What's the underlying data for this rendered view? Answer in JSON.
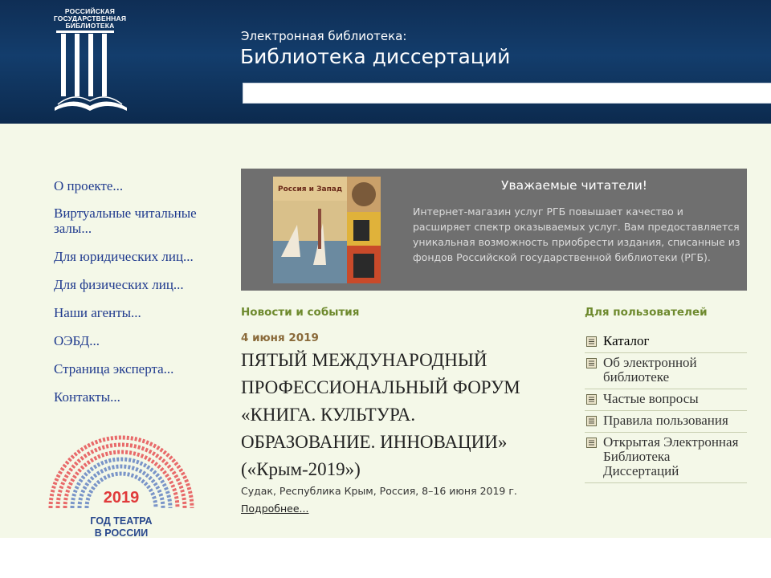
{
  "header": {
    "logo_lines": [
      "РОССИЙСКАЯ",
      "ГОСУДАРСТВЕННАЯ",
      "БИБЛИОТЕКА"
    ],
    "subtitle": "Электронная библиотека:",
    "title": "Библиотека диссертаций",
    "search_value": ""
  },
  "nav": {
    "items": [
      "О проекте...",
      "Виртуальные читальные залы...",
      "Для юридических лиц...",
      "Для физических лиц...",
      "Наши агенты...",
      "ОЭБД...",
      "Страница эксперта...",
      "Контакты..."
    ]
  },
  "theatre_logo": {
    "year": "2019",
    "caption_lines": [
      "ГОД ТЕАТРА",
      "В РОССИИ"
    ]
  },
  "banner": {
    "image_label": "Россия и Запад",
    "title": "Уважаемые читатели!",
    "text": "Интернет-магазин услуг РГБ повышает качество и расширяет спектр оказываемых услуг. Вам предоставляется уникальная возможность приобрести издания, списанные из фондов Российской государственной библиотеки (РГБ)."
  },
  "news": {
    "heading": "Новости и события",
    "date": "4 июня 2019",
    "title_lines": [
      "ПЯТЫЙ МЕЖДУНАРОДНЫЙ",
      "ПРОФЕССИОНАЛЬНЫЙ ФОРУМ",
      "«КНИГА. КУЛЬТУРА.",
      "ОБРАЗОВАНИЕ. ИННОВАЦИИ»",
      "(«Крым-2019»)"
    ],
    "place": "Судак, Республика Крым, Россия, 8–16 июня 2019 г.",
    "more": "Подробнее..."
  },
  "users": {
    "heading": "Для пользователей",
    "items": [
      "Каталог",
      "Об электронной библиотеке",
      "Частые вопросы",
      "Правила пользования",
      "Открытая Электронная Библиотека Диссертаций"
    ]
  },
  "colors": {
    "header_bg": "#133d6c",
    "content_bg": "#f4f8e8",
    "nav_link": "#1f3a8e",
    "section_heading": "#6e8a2e",
    "news_date": "#8a6a3a",
    "banner_bg": "#6f6f6f"
  }
}
